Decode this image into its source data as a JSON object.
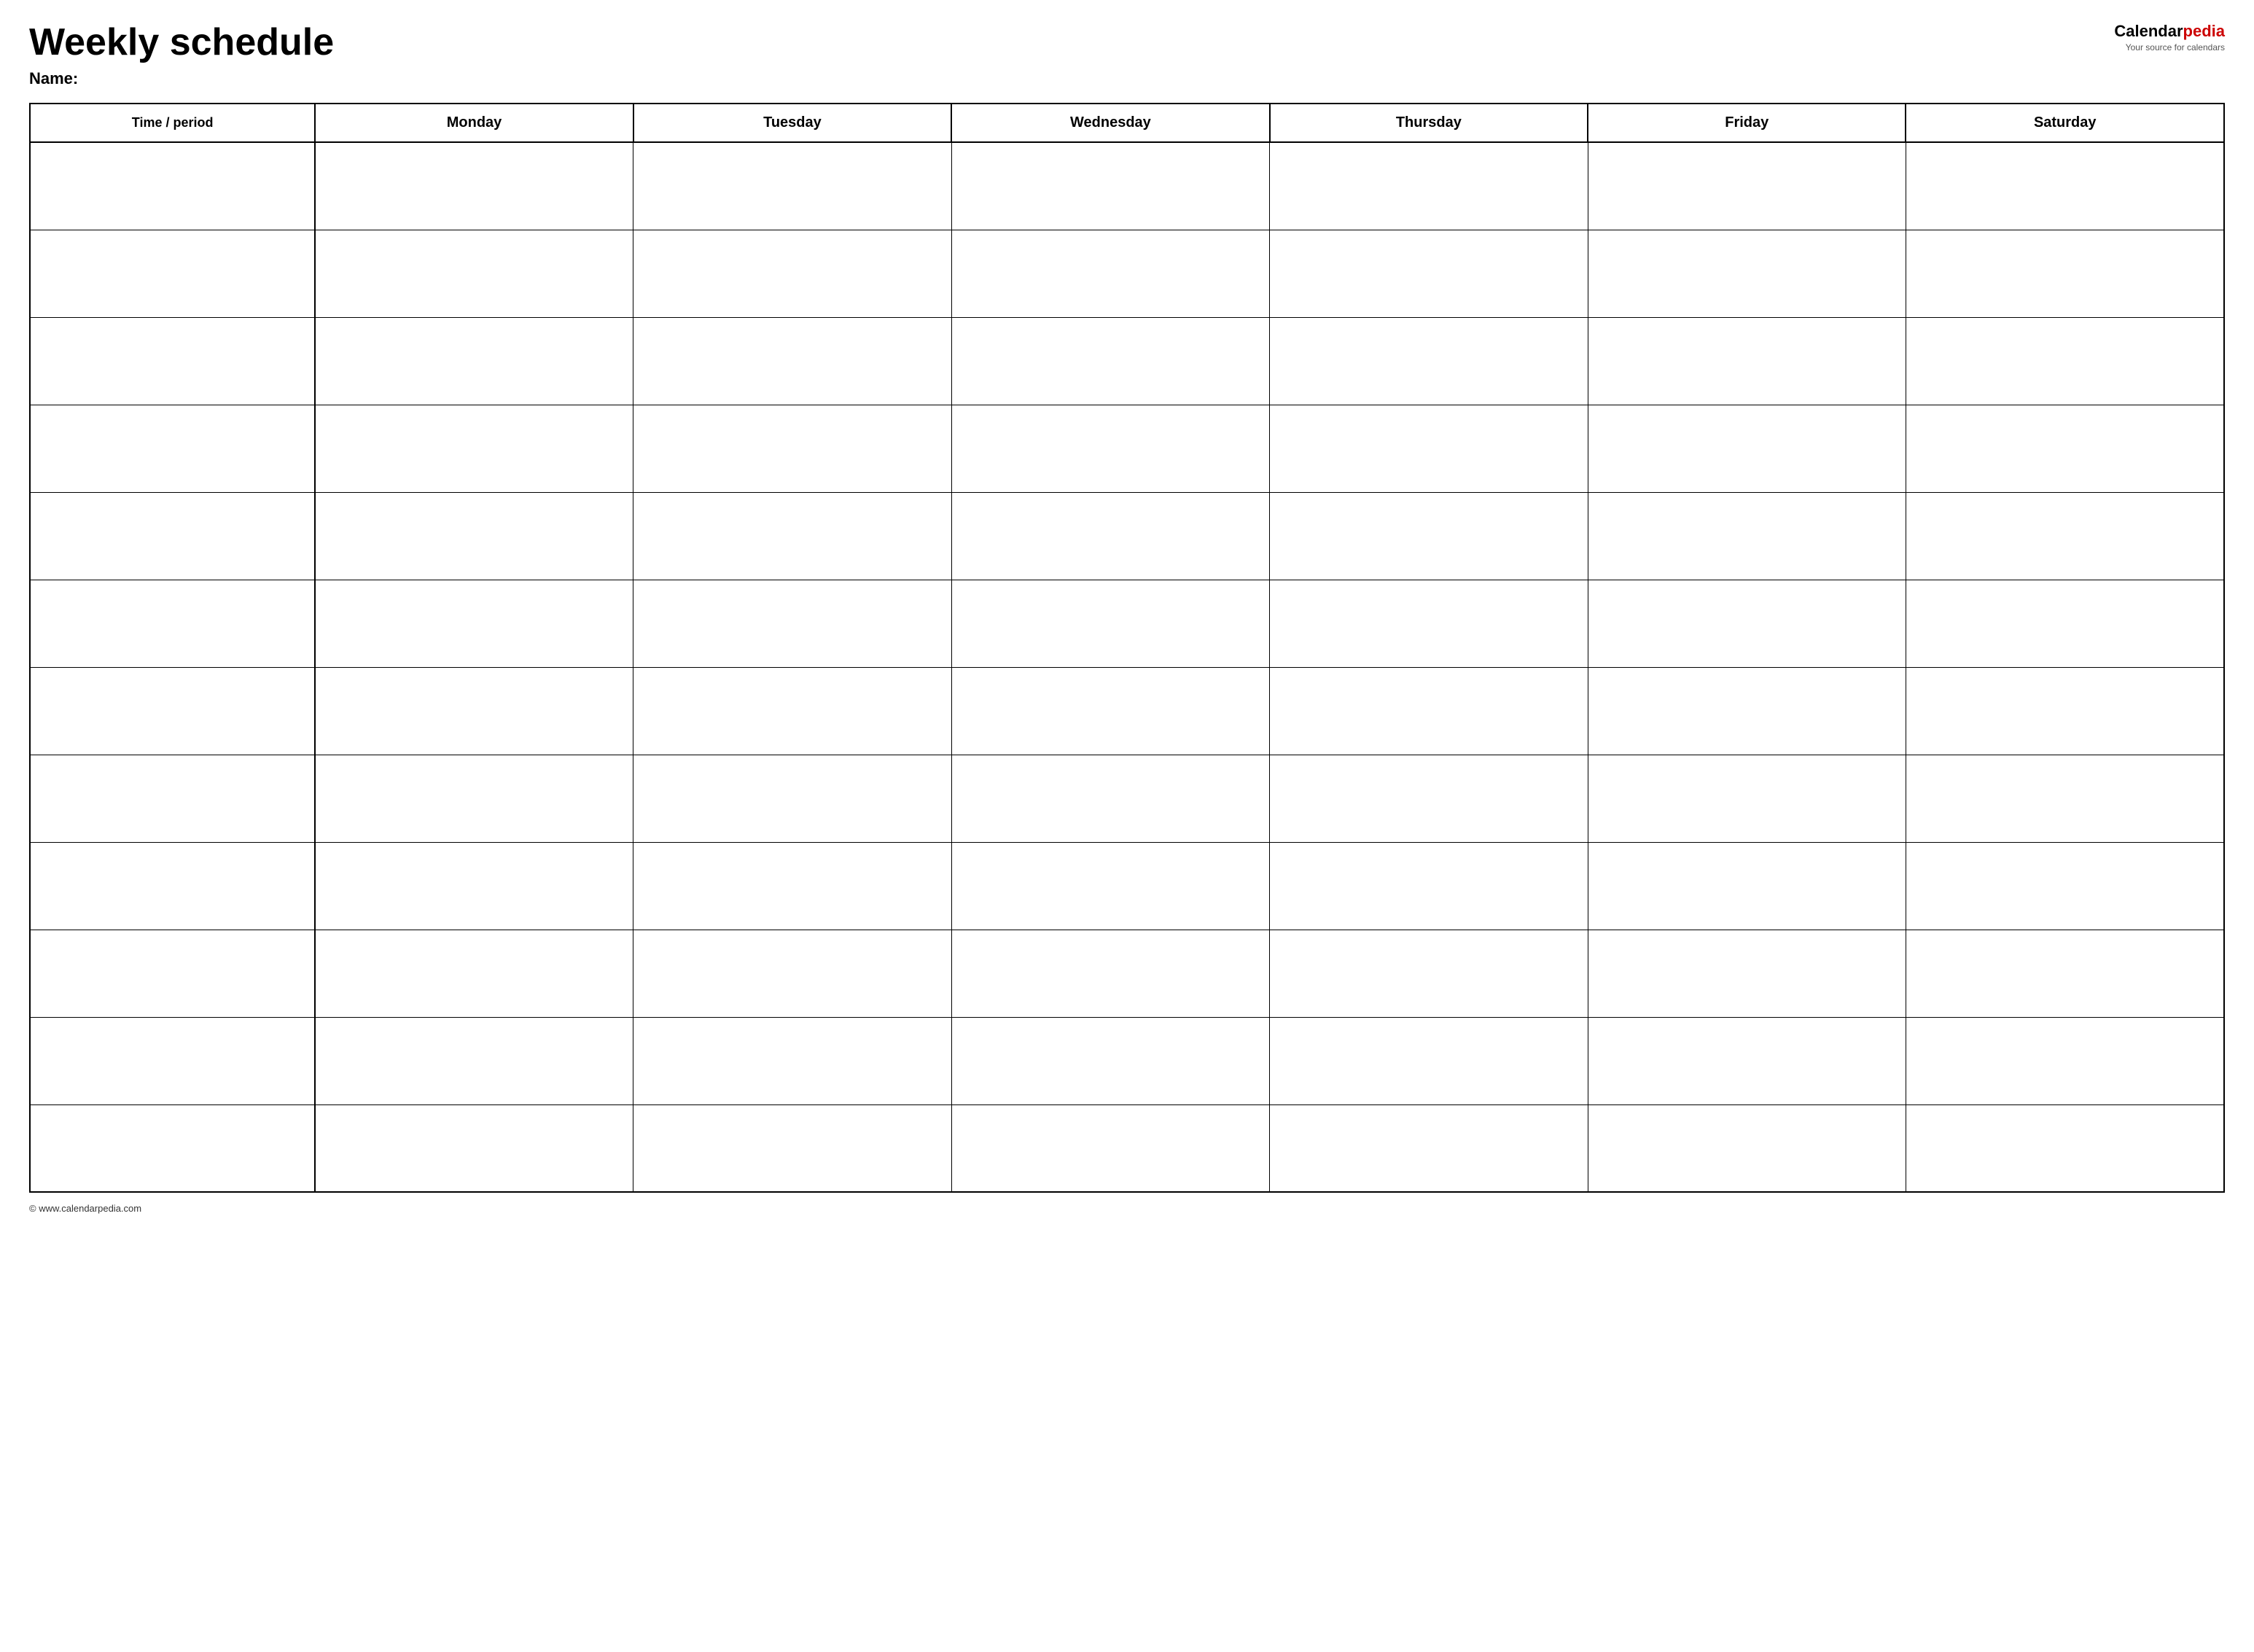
{
  "header": {
    "title": "Weekly schedule",
    "name_label": "Name:",
    "logo_calendar": "Calendar",
    "logo_pedia": "pedia",
    "logo_tagline": "Your source for calendars"
  },
  "table": {
    "columns": [
      {
        "label": "Time / period",
        "type": "time"
      },
      {
        "label": "Monday",
        "type": "day"
      },
      {
        "label": "Tuesday",
        "type": "day"
      },
      {
        "label": "Wednesday",
        "type": "day"
      },
      {
        "label": "Thursday",
        "type": "day"
      },
      {
        "label": "Friday",
        "type": "day"
      },
      {
        "label": "Saturday",
        "type": "day"
      }
    ],
    "row_count": 12
  },
  "footer": {
    "text": "© www.calendarpedia.com"
  }
}
